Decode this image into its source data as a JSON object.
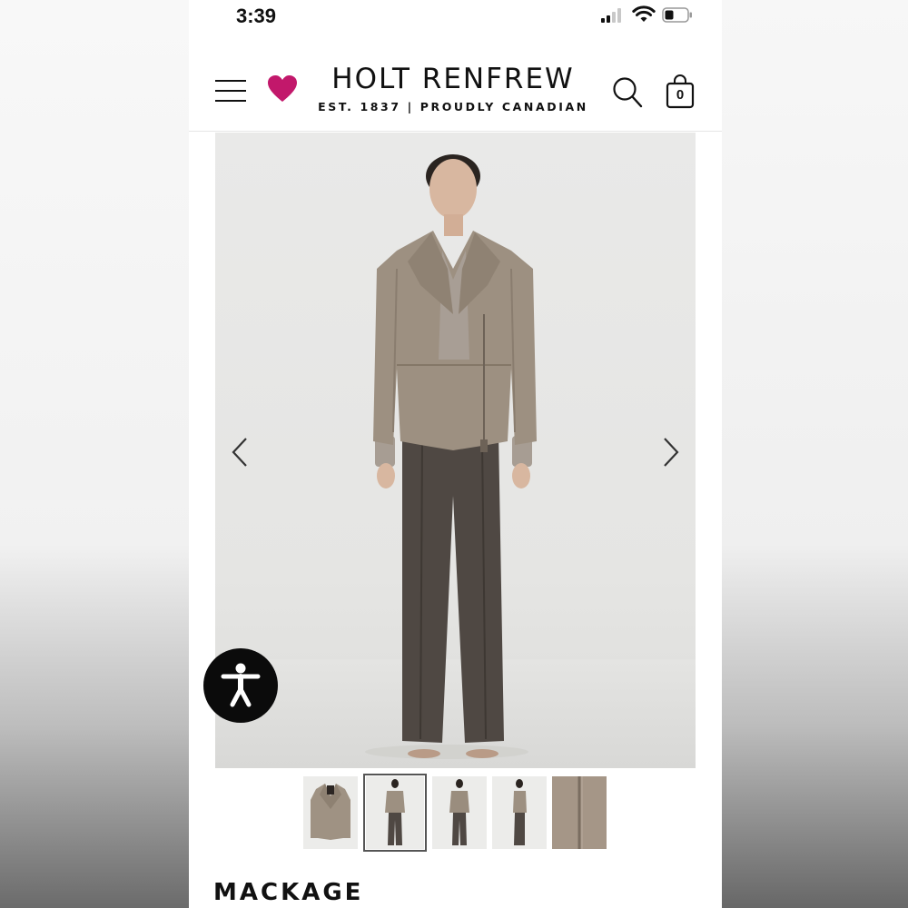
{
  "status_bar": {
    "time": "3:39"
  },
  "header": {
    "brand_name": "HOLT RENFREW",
    "brand_tagline": "EST. 1837 | PROUDLY CANADIAN",
    "bag_count": "0",
    "icons": [
      "menu-icon",
      "heart-icon",
      "search-icon",
      "shopping-bag-icon"
    ],
    "heart_color": "#c2186b"
  },
  "gallery": {
    "thumbnails": [
      "jacket-front",
      "full-look-front",
      "full-look-back",
      "full-look-side",
      "zipper-detail"
    ],
    "active_index": 1
  },
  "product": {
    "brand": "MACKAGE"
  }
}
